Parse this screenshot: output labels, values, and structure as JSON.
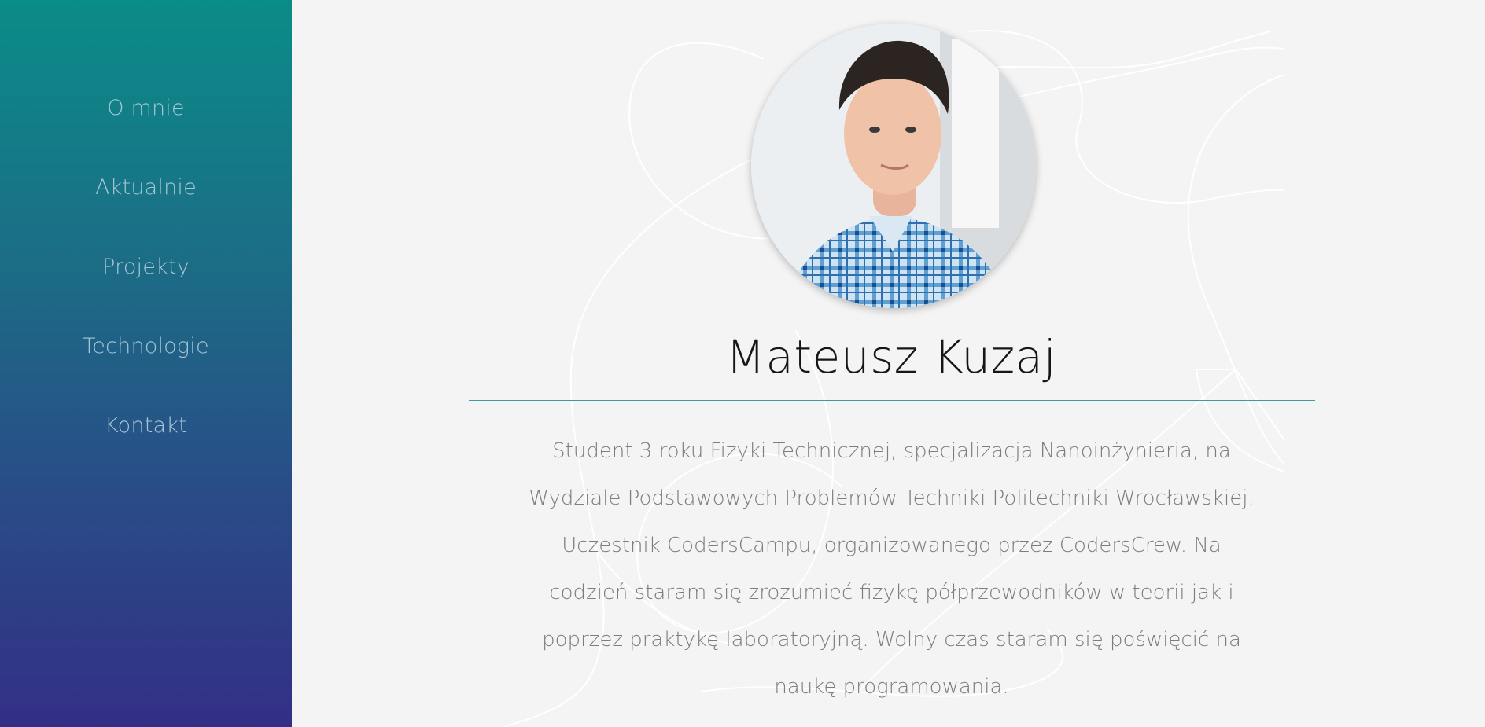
{
  "nav": {
    "items": [
      {
        "label": "O mnie"
      },
      {
        "label": "Aktualnie"
      },
      {
        "label": "Projekty"
      },
      {
        "label": "Technologie"
      },
      {
        "label": "Kontakt"
      }
    ]
  },
  "profile": {
    "name": "Mateusz Kuzaj",
    "bio": "Student 3 roku Fizyki Technicznej, specjalizacja Nanoinżynieria, na Wydziale Podstawowych Problemów Techniki Politechniki Wrocławskiej. Uczestnik CodersCampu, organizowanego przez CodersCrew. Na codzień staram się zrozumieć fizykę półprzewodników w teorii jak i poprzez praktykę laboratoryjną. Wolny czas staram się poświęcić na naukę programowania."
  },
  "colors": {
    "sidebar_top": "#0a8c88",
    "sidebar_bottom": "#332f86",
    "accent_line": "#3c9aa0",
    "background": "#f4f4f4"
  }
}
